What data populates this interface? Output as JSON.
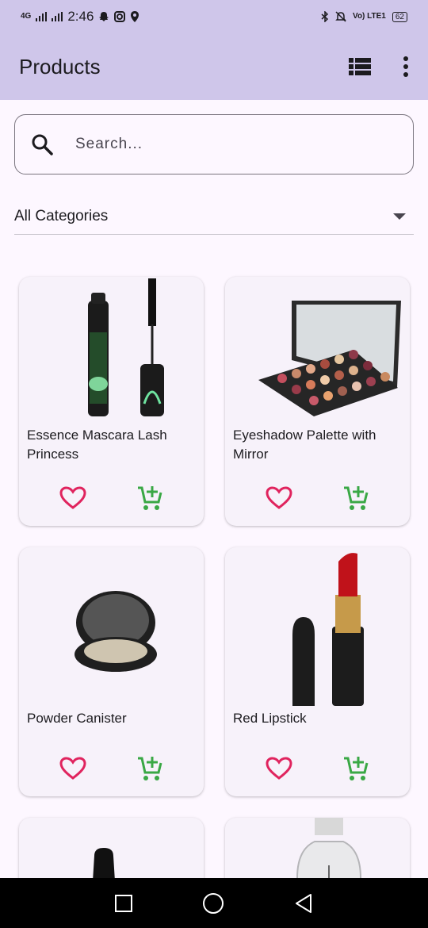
{
  "status": {
    "network": "4G",
    "time": "2:46",
    "volte": "Vo) LTE1",
    "battery": "62"
  },
  "app_bar": {
    "title": "Products",
    "list_view_icon": "view-list-icon",
    "more_icon": "more-vert-icon"
  },
  "search": {
    "placeholder": "Search...",
    "icon": "search-icon"
  },
  "category": {
    "selected": "All Categories"
  },
  "colors": {
    "app_bar": "#cfc6ea",
    "heart": "#e0245e",
    "cart": "#3aa845",
    "background": "#fdf7ff"
  },
  "products": [
    {
      "name": "Essence Mascara Lash Princess"
    },
    {
      "name": "Eyeshadow Palette with Mirror"
    },
    {
      "name": "Powder Canister"
    },
    {
      "name": "Red Lipstick"
    },
    {
      "name": ""
    },
    {
      "name": ""
    }
  ]
}
